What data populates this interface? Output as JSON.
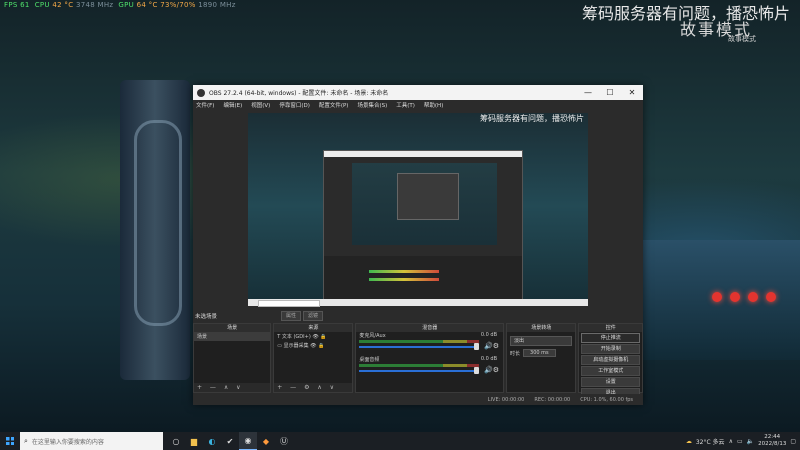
{
  "hud": {
    "fps_label": "FPS",
    "fps": "61",
    "cpu_label": "CPU",
    "cpu_temp": "42 °C",
    "cpu_freq": "3748 MHz",
    "gpu_label": "GPU",
    "gpu_temp": "64 °C",
    "gpu_usage": "73%/70%",
    "gpu_freq": "1890 MHz"
  },
  "watermark": {
    "title": "筹码服务器有问题，播恐怖片",
    "logo": "故事模式",
    "sub": "故事模式"
  },
  "obs": {
    "title": "OBS 27.2.4 (64-bit, windows) - 配置文件: 未命名 - 场景: 未命名",
    "window_controls": [
      "—",
      "☐",
      "✕"
    ],
    "menu": [
      "文件(F)",
      "编辑(E)",
      "视图(V)",
      "停靠窗口(D)",
      "配置文件(P)",
      "场景集合(S)",
      "工具(T)",
      "帮助(H)"
    ],
    "preview_watermark": "筹码服务器有问题，播恐怖片",
    "scene_row": {
      "name": "未选场景",
      "buttons": [
        "属性",
        "滤镜"
      ]
    },
    "docks": {
      "scenes": {
        "title": "场景",
        "items": [
          "场景"
        ],
        "footer": "+ — ∧ ∨"
      },
      "sources": {
        "title": "来源",
        "items": [
          "文本 (GDI+)",
          "显示器采集"
        ],
        "footer": "+ — ⚙ ∧ ∨"
      },
      "mixer": {
        "title": "混音器",
        "channels": [
          {
            "name": "麦克风/Aux",
            "db": "0.0 dB"
          },
          {
            "name": "桌面音频",
            "db": "0.0 dB"
          }
        ]
      },
      "transitions": {
        "title": "场景转场",
        "selected": "淡出",
        "duration_label": "时长",
        "duration": "300 ms"
      },
      "controls": {
        "title": "控件",
        "buttons": [
          "停止推流",
          "开始录制",
          "启动虚拟摄像机",
          "工作室模式",
          "设置",
          "退出"
        ]
      }
    },
    "status": [
      "LIVE: 00:00:00",
      "REC: 00:00:00",
      "CPU: 1.0%, 60.00 fps"
    ]
  },
  "taskbar": {
    "search_placeholder": "在这里输入你要搜索的内容",
    "weather": "32°C 多云",
    "time": "22:44",
    "date": "2022/8/13"
  }
}
